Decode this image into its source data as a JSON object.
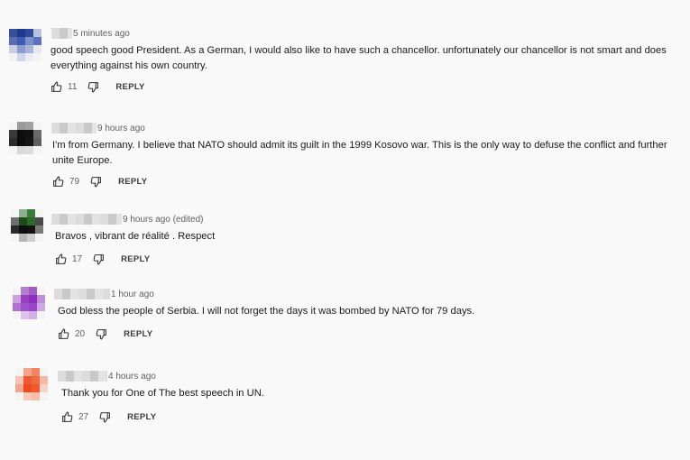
{
  "comments": [
    {
      "time": "5 minutes ago",
      "text": "good speech good President.  As a German, I would also like to have such a chancellor.  unfortunately our chancellor is not smart and does everything against his own country.",
      "likes": "11",
      "reply": "REPLY",
      "avatar_colors": [
        "#3a4f9a",
        "#1f3a8a",
        "#2e4a9e",
        "#b9c3dc",
        "#5a6bb0",
        "#3d5bb7",
        "#7e8fc7",
        "#5b70c0",
        "#c8cfe4",
        "#8d9bcf",
        "#a9b4da",
        "#e6e9f2",
        "#f2f2f2",
        "#cfd5ea",
        "#e9ecf4",
        "#f4f4f4"
      ]
    },
    {
      "time": "9 hours ago",
      "text": "I'm from Germany. I believe that NATO should admit its guilt in the 1999 Kosovo war. This is the only way to defuse the conflict and further unite Europe.",
      "likes": "79",
      "reply": "REPLY",
      "avatar_colors": [
        "#f4f4f4",
        "#9a9a9a",
        "#a2a2a2",
        "#f4f4f4",
        "#3a3a3a",
        "#0e0e0e",
        "#111111",
        "#6a6a6a",
        "#2d2d2d",
        "#0c0c0c",
        "#141414",
        "#5f5f5f",
        "#f4f4f4",
        "#d8d8d8",
        "#dcdcdc",
        "#f4f4f4"
      ]
    },
    {
      "time": "9 hours ago (edited)",
      "text": "Bravos  , vibrant de  réalité   . Respect",
      "likes": "17",
      "reply": "REPLY",
      "avatar_colors": [
        "#f4f4f4",
        "#8fae8f",
        "#3d7a3d",
        "#f4f4f4",
        "#6f6f6f",
        "#1d4a1d",
        "#2a6a2a",
        "#4a4a4a",
        "#2a2a2a",
        "#0f0f0f",
        "#121212",
        "#7a7a7a",
        "#f4f4f4",
        "#b5b5b5",
        "#cfcfcf",
        "#f4f4f4"
      ]
    },
    {
      "time": "1 hour ago",
      "text": "God bless the people of Serbia. I will not forget the days it was bombed by NATO for 79 days.",
      "likes": "20",
      "reply": "REPLY",
      "avatar_colors": [
        "#f4f4f4",
        "#b57fd0",
        "#a35bc6",
        "#f4f4f4",
        "#c9a3de",
        "#9740c2",
        "#8b2fbd",
        "#c08ed8",
        "#b071d0",
        "#a050cb",
        "#9a45c7",
        "#cfa7e2",
        "#f4f4f4",
        "#dcc3ea",
        "#d2b2e5",
        "#f4f4f4"
      ]
    },
    {
      "time": "4 hours ago",
      "text": "Thank you for One of The best speech in UN.",
      "likes": "27",
      "reply": "REPLY",
      "avatar_colors": [
        "#f4f4f4",
        "#f2a58c",
        "#f08463",
        "#f4f4f4",
        "#f5c3b2",
        "#ee5a34",
        "#f06a46",
        "#f4b9a6",
        "#f2a590",
        "#ef4a1e",
        "#f05a2e",
        "#f6d3c6",
        "#f4f4f4",
        "#f7c9b8",
        "#f5bca7",
        "#f4f4f4"
      ]
    }
  ]
}
